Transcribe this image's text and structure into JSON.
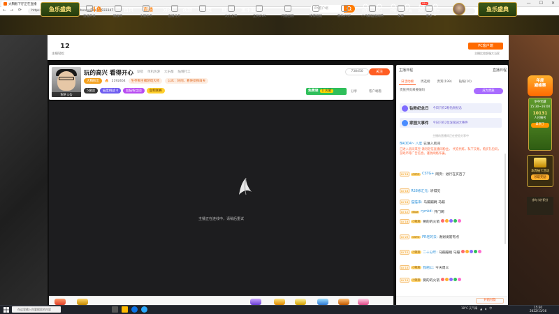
{
  "browser": {
    "tab_title": "大胸骰下厅正在直播",
    "url": "https://www.douyu.com/topic/shenhei?rid=7933347",
    "back": "←",
    "forward": "→",
    "reload": "⟳",
    "minimize": "—",
    "maximize": "☐",
    "close": "✕"
  },
  "header": {
    "fish_logo_left": "鱼乐盛典",
    "fish_logo_right": "鱼乐盛典",
    "site_logo": "斗鱼",
    "nav": [
      "首页",
      "直播",
      "分类",
      "视频",
      "游戏",
      "鱼吧",
      "鱼乐盛典"
    ],
    "active_nav": 1,
    "search_placeholder": "IPX客户端",
    "icons": [
      {
        "label": "历史",
        "icon": "clock-icon"
      },
      {
        "label": "关注",
        "icon": "heart-icon"
      },
      {
        "label": "开播",
        "icon": "camera-icon"
      },
      {
        "label": "客户端",
        "icon": "download-icon"
      },
      {
        "label": "消息",
        "icon": "mail-icon"
      },
      {
        "label": "创作中心",
        "icon": "lightbulb-icon"
      }
    ],
    "msg_badge": "99+"
  },
  "toolbar": {
    "level_num": "12",
    "level_label": "主播轻松",
    "items": [
      "直播开关",
      "播放鸡",
      "主播任务",
      "直播任务",
      "",
      "大力全开",
      "全民GVK",
      "月圆团圆",
      "撩撩招能",
      "游乐VVIP",
      "小飞鲸运维闹腾",
      "友家",
      "更多"
    ],
    "pc_client": "PC客户端",
    "pc_client_sub": "主播比较舒服大当家"
  },
  "room": {
    "title": "玩的高兴 看得开心",
    "tags": [
      "穿搭",
      "单机热游",
      "大乐都",
      "陆晴打工"
    ],
    "anchor_name": "大胸骰出",
    "hot": "2192464",
    "notice1": "生存狮王捕游戏大师",
    "notice2": "公众：好闲、看侠侦探白天",
    "avatar_caption": "鱼粑  公告",
    "pill_level": "5级团",
    "pill_fans": "猫度挑战",
    "pill_fans_num": "0",
    "pill_rank": "超猫粉丝团",
    "pill_star": "鱼粑联赛",
    "follow_count": "738450",
    "follow_btn": "关注",
    "free_btn": "免费领",
    "free_btn_num": "1 火箭",
    "share": "分享",
    "client_watch": "客户端看"
  },
  "video": {
    "loading_msg": "主播正在连线中，请稍后重试"
  },
  "panel": {
    "tabs1": [
      "主播日程",
      "直播日程"
    ],
    "tabs2": [
      "日活动榜",
      "周选榜",
      "贵宾(199)",
      "钻粉(10)"
    ],
    "active_tab2": 0,
    "noble_label": "贵族开房来要做吗",
    "noble_btn": "成为贵族",
    "banner1_title": "钻粉纪念日",
    "banner1_sub": "今日只有2粉钻粉纪念",
    "banner2_title": "家园大事件",
    "banner2_sub": "今日只有2位发家园大事件",
    "chat_notice": "主播的直播间正在经验分享中",
    "messages": [
      {
        "lv": "",
        "badge": "",
        "nick": "BAOD4~ 八度",
        "text": "已进入房间"
      },
      {
        "lv": "",
        "badge": "",
        "nick": "",
        "text": "已进入房间来宝 请勿轻信直播间粉丝， 代充代练，私下交易。购买礼包码，游戏币等广告信息。谨防网络诈骗。"
      },
      {
        "lv": "LV 16",
        "badge": "CSTG",
        "nick": "CSTG+",
        "text": "网页：进行在买百了"
      },
      {
        "lv": "LV 16",
        "badge": "",
        "nick": "RS8修汇元:",
        "text": "听得见"
      },
      {
        "lv": "LV 16",
        "badge": "",
        "nick": "猫猫来:",
        "text": "马蹦蹦跳 马蹦"
      },
      {
        "lv": "LV 12",
        "badge": "Blue",
        "nick": "rymkd:",
        "text": "开门啊"
      },
      {
        "lv": "LV 16",
        "badge": "小姐姐",
        "nick": "",
        "text": "要的的火箭"
      },
      {
        "lv": "LV 23",
        "badge": "CSTG",
        "nick": "PR老的去:",
        "text": "谢谢发箭有点"
      },
      {
        "lv": "LV 15",
        "badge": "小姐姐",
        "nick": "二十分年:",
        "text": "马蹦蹦跳 马蹦"
      },
      {
        "lv": "LV 15",
        "badge": "小姐姐",
        "nick": "我相公:",
        "text": "今天周三"
      },
      {
        "lv": "LV 14",
        "badge": "小姐姐",
        "nick": "",
        "text": "要的的火箭"
      }
    ],
    "pay_btn": "开始付款"
  },
  "ads": {
    "top": "年度\n巅峰赛",
    "poster_line1": "争夺宝藏",
    "poster_time": "15:30~16:00",
    "poster_num": "10131",
    "poster_line2": "人已报名",
    "poster_btn": "拿到了",
    "box_title": "本周抽卡活动",
    "box_btn": "领取奖励",
    "box_caption": "参与卡片积分"
  },
  "taskbar": {
    "search_placeholder": "在这里输入你要搜索的内容",
    "weather": "18°C 天气晴",
    "lang": "中",
    "time": "15:30",
    "date": "2022/11/16"
  },
  "colors": {
    "accent": "#ff5d23",
    "brand": "#ff7a00",
    "green": "#2fbf5a"
  }
}
